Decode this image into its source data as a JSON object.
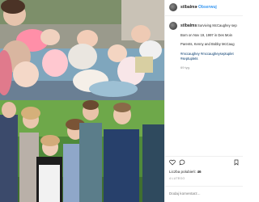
{
  "post": {
    "username": "stlbalms",
    "follow_separator": "•",
    "follow_label": "Obserwuj",
    "caption": {
      "username": "stlbalms",
      "line1": "Surviving McCaughey sep",
      "line2": "Born on Nov 19, 1997 in Des Moin",
      "line3": "Parents, Kenny and Bobby McCaug",
      "line4": "#mccaughey #mccaugheyseptuplet",
      "line5": "#septuplets",
      "time_ago": "69 tyg."
    },
    "likes_label": "Liczba polubień:",
    "likes_count": "46",
    "date": "4 LUTEGO",
    "comment_placeholder": "Dodaj komentarz..."
  },
  "icons": {
    "more": "more-options-icon",
    "heart": "heart-icon",
    "comment": "comment-icon",
    "save": "bookmark-icon"
  },
  "colors": {
    "link": "#3897f0",
    "text": "#262626",
    "muted": "#8e8e8e",
    "hashtag": "#00376b",
    "divider": "#efefef"
  }
}
